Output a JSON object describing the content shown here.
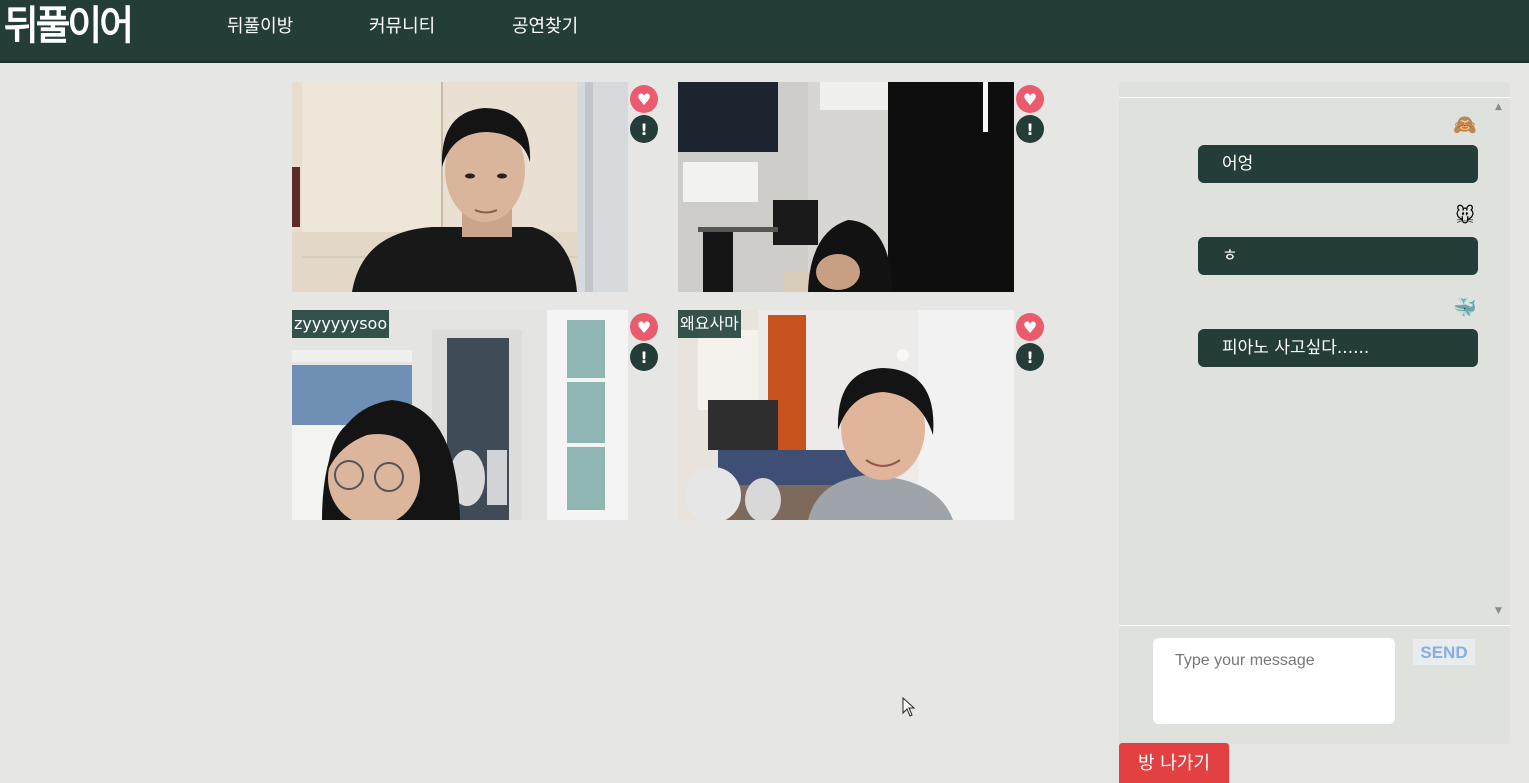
{
  "header": {
    "logo": "뒤풀이어",
    "nav": [
      "뒤풀이방",
      "커뮤니티",
      "공연찾기"
    ]
  },
  "videos": [
    {
      "name": ""
    },
    {
      "name": ""
    },
    {
      "name": "zyyyyyysoo"
    },
    {
      "name": "왜요사마"
    }
  ],
  "chat": {
    "messages": [
      {
        "avatar_icon": "monkey-icon",
        "avatar": "🙈",
        "text": "어엉"
      },
      {
        "avatar_icon": "mouse-icon",
        "avatar": "🐭",
        "text": "ㅎ"
      },
      {
        "avatar_icon": "whale-icon",
        "avatar": "🐳",
        "text": "피아노 사고싶다......"
      }
    ],
    "input_placeholder": "Type your message",
    "input_value": "",
    "send_label": "SEND"
  },
  "leave_label": "방 나가기",
  "colors": {
    "nav_bg": "#243d39",
    "bubble_bg": "#243d39",
    "heart": "#ea5b6d",
    "leave": "#e34141",
    "send_text": "#86aee0",
    "page_bg": "#e6e6e5"
  }
}
